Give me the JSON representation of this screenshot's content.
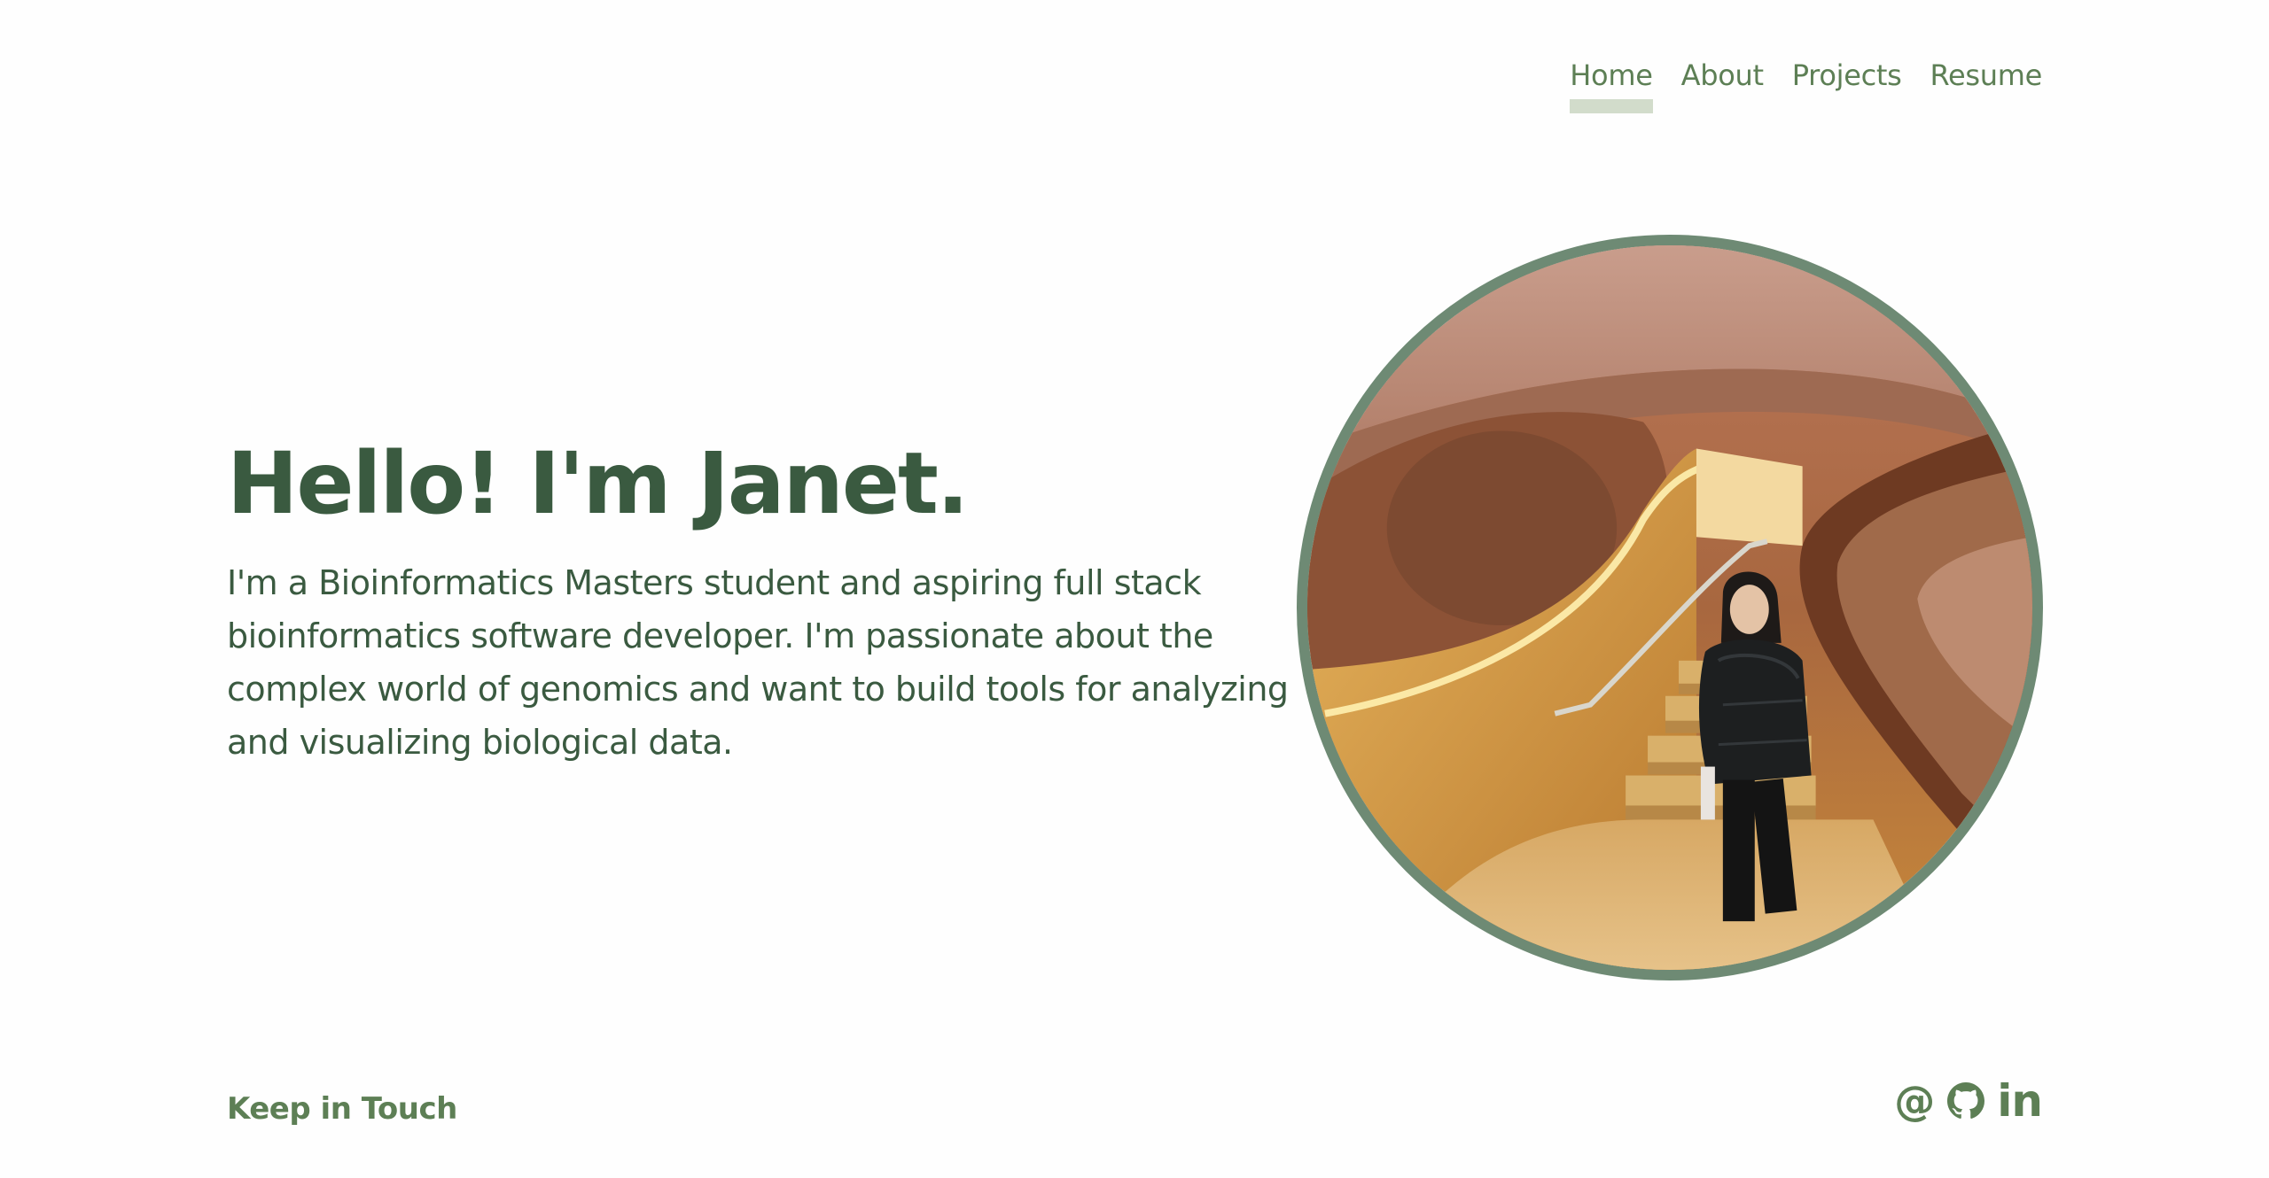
{
  "nav": {
    "items": [
      {
        "label": "Home",
        "active": true
      },
      {
        "label": "About",
        "active": false
      },
      {
        "label": "Projects",
        "active": false
      },
      {
        "label": "Resume",
        "active": false
      }
    ]
  },
  "hero": {
    "title": "Hello! I'm Janet.",
    "description": "I'm a Bioinformatics Masters student and aspiring full stack bioinformatics software developer. I'm passionate about the complex world of genomics and want to build tools for analyzing and visualizing biological data."
  },
  "portrait": {
    "icon": "portrait-photo"
  },
  "footer": {
    "keep_in_touch": "Keep in Touch",
    "social": [
      {
        "icon": "email-at-icon"
      },
      {
        "icon": "github-icon"
      },
      {
        "icon": "linkedin-icon"
      }
    ]
  },
  "colors": {
    "primary_dark": "#3a5a40",
    "accent": "#5d7f55",
    "nav_underline": "#d2dccb",
    "portrait_border": "#6e8a74"
  }
}
